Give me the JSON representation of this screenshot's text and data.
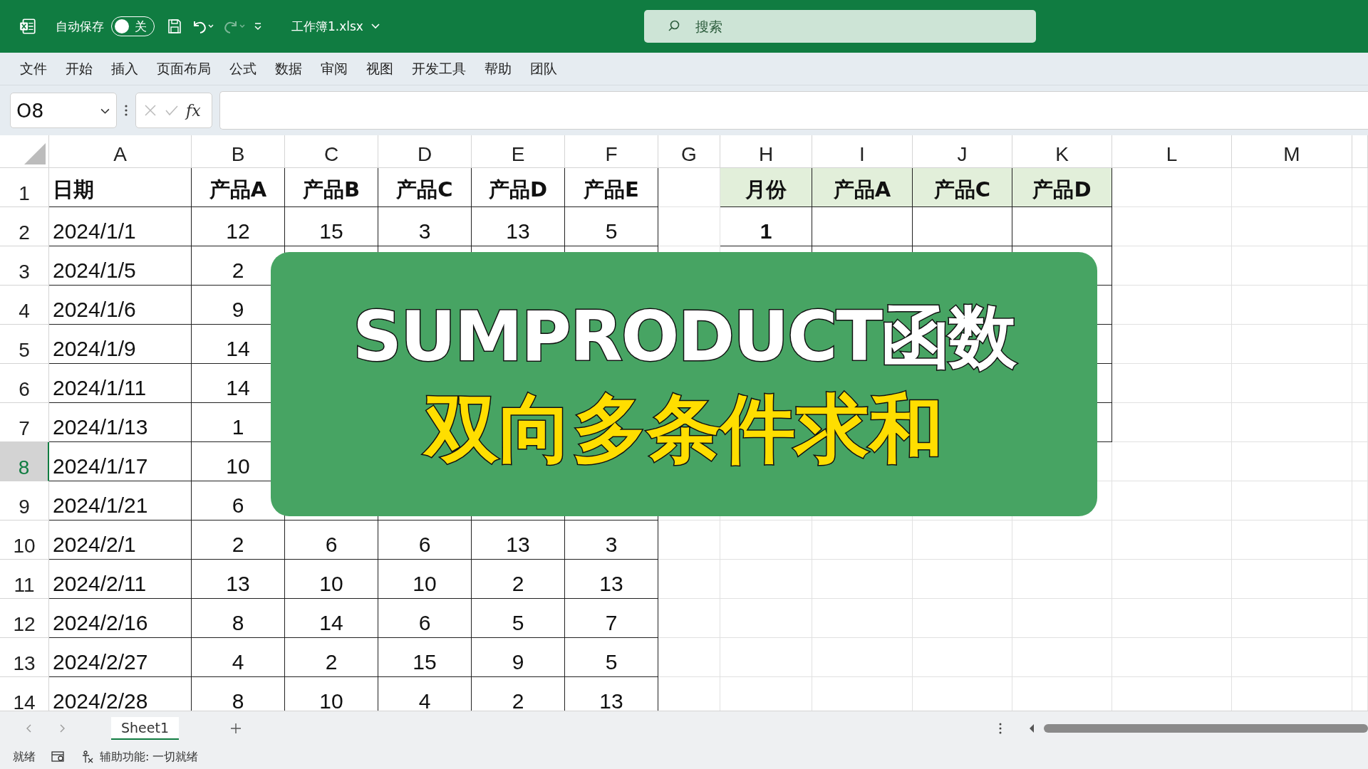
{
  "title_bar": {
    "autosave_label": "自动保存",
    "autosave_toggle": {
      "on": false,
      "label": "关"
    },
    "file_name": "工作簿1.xlsx",
    "search": {
      "placeholder": "搜索"
    }
  },
  "ribbon_tabs": [
    "文件",
    "开始",
    "插入",
    "页面布局",
    "公式",
    "数据",
    "审阅",
    "视图",
    "开发工具",
    "帮助",
    "团队"
  ],
  "name_box": "O8",
  "formula_bar": {
    "fx_label": "fx"
  },
  "columns": [
    "A",
    "B",
    "C",
    "D",
    "E",
    "F",
    "G",
    "H",
    "I",
    "J",
    "K",
    "L",
    "M"
  ],
  "rows": [
    {
      "number": "1",
      "selected": false,
      "cells": [
        "日期",
        "产品A",
        "产品B",
        "产品C",
        "产品D",
        "产品E",
        null,
        "月份",
        "产品A",
        "产品C",
        "产品D"
      ]
    },
    {
      "number": "2",
      "selected": false,
      "cells": [
        "2024/1/1",
        "12",
        "15",
        "3",
        "13",
        "5",
        null,
        "1",
        null,
        null,
        null
      ]
    },
    {
      "number": "3",
      "selected": false,
      "cells": [
        "2024/1/5",
        "2",
        null,
        null,
        null,
        null,
        null,
        null,
        null,
        null,
        null
      ]
    },
    {
      "number": "4",
      "selected": false,
      "cells": [
        "2024/1/6",
        "9",
        null,
        null,
        null,
        null,
        null,
        null,
        null,
        null,
        null
      ]
    },
    {
      "number": "5",
      "selected": false,
      "cells": [
        "2024/1/9",
        "14",
        null,
        null,
        null,
        null,
        null,
        null,
        null,
        null,
        null
      ]
    },
    {
      "number": "6",
      "selected": false,
      "cells": [
        "2024/1/11",
        "14",
        null,
        null,
        null,
        null,
        null,
        null,
        null,
        null,
        null
      ]
    },
    {
      "number": "7",
      "selected": false,
      "cells": [
        "2024/1/13",
        "1",
        null,
        null,
        null,
        null,
        null,
        null,
        null,
        null,
        null
      ]
    },
    {
      "number": "8",
      "selected": true,
      "cells": [
        "2024/1/17",
        "10",
        null,
        null,
        null,
        null,
        null,
        null,
        null,
        null,
        null
      ]
    },
    {
      "number": "9",
      "selected": false,
      "cells": [
        "2024/1/21",
        "6",
        null,
        null,
        null,
        null,
        null,
        null,
        null,
        null,
        null
      ]
    },
    {
      "number": "10",
      "selected": false,
      "cells": [
        "2024/2/1",
        "2",
        "6",
        "6",
        "13",
        "3",
        null,
        null,
        null,
        null,
        null
      ]
    },
    {
      "number": "11",
      "selected": false,
      "cells": [
        "2024/2/11",
        "13",
        "10",
        "10",
        "2",
        "13",
        null,
        null,
        null,
        null,
        null
      ]
    },
    {
      "number": "12",
      "selected": false,
      "cells": [
        "2024/2/16",
        "8",
        "14",
        "6",
        "5",
        "7",
        null,
        null,
        null,
        null,
        null
      ]
    },
    {
      "number": "13",
      "selected": false,
      "cells": [
        "2024/2/27",
        "4",
        "2",
        "15",
        "9",
        "5",
        null,
        null,
        null,
        null,
        null
      ]
    },
    {
      "number": "14",
      "selected": false,
      "cells": [
        "2024/2/28",
        "8",
        "10",
        "4",
        "2",
        "13",
        null,
        null,
        null,
        null,
        null
      ]
    }
  ],
  "banner": {
    "title": "SUMPRODUCT函数",
    "subtitle": "双向多条件求和"
  },
  "sheet_tabs": [
    {
      "label": "Sheet1",
      "selected": true
    }
  ],
  "status_bar": {
    "ready": "就绪",
    "accessibility": "辅助功能: 一切就绪"
  }
}
